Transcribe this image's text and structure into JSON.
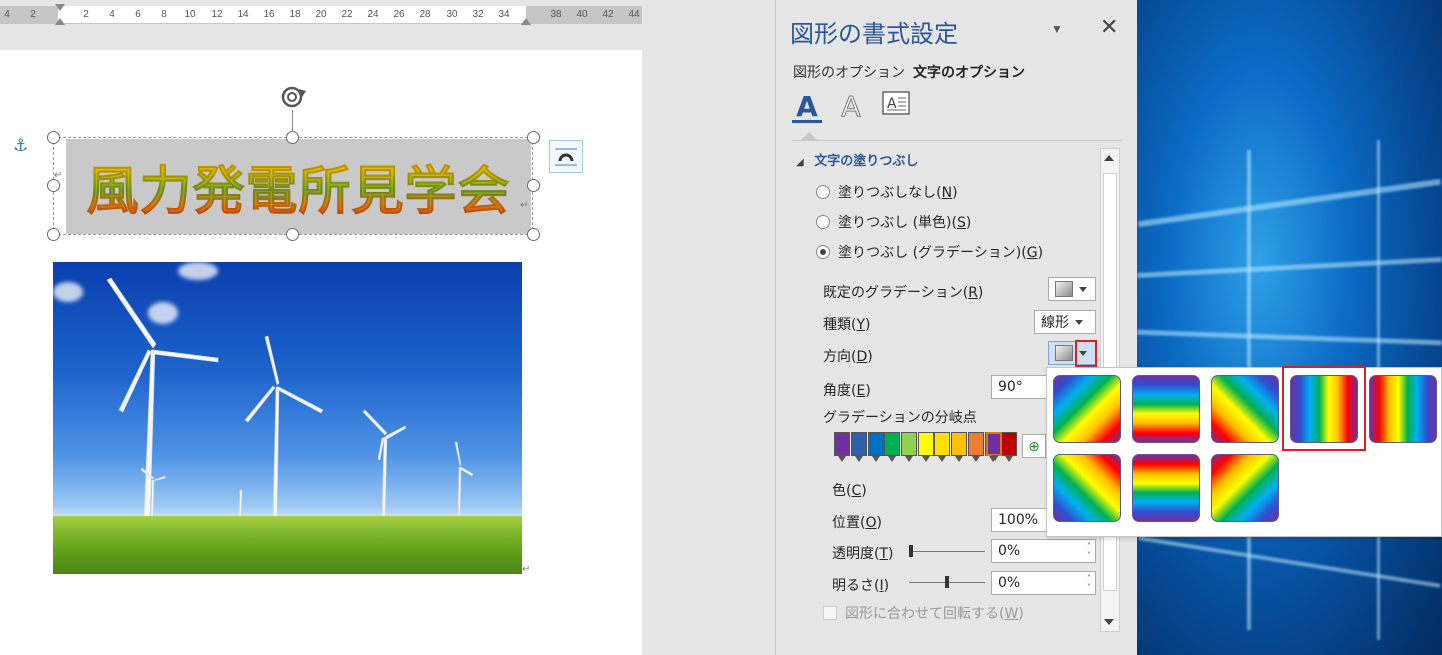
{
  "ruler": {
    "ticks": [
      "4",
      "2",
      "2",
      "4",
      "6",
      "8",
      "10",
      "12",
      "14",
      "16",
      "18",
      "20",
      "22",
      "24",
      "26",
      "28",
      "30",
      "32",
      "34",
      "38",
      "40",
      "42",
      "44"
    ]
  },
  "document": {
    "wordart_text": "風力発電所見学会",
    "paragraph_mark": "↵",
    "anchor_icon": "anchor-icon",
    "image_subject": "wind-turbines-photo"
  },
  "pane": {
    "title": "図形の書式設定",
    "tabs": [
      "図形のオプション",
      "文字のオプション"
    ],
    "active_tab": "文字のオプション",
    "icon_tabs": [
      "text-fill-icon",
      "text-outline-icon",
      "text-box-icon"
    ],
    "section": {
      "title": "文字の塗りつぶし",
      "fill_options": {
        "none": {
          "text": "塗りつぶしなし(",
          "key": "N",
          "end": ")"
        },
        "solid": {
          "text": "塗りつぶし (単色)(",
          "key": "S",
          "end": ")"
        },
        "gradient": {
          "text": "塗りつぶし (グラデーション)(",
          "key": "G",
          "end": ")"
        }
      },
      "selected_fill": "gradient",
      "preset_gradient": {
        "text": "既定のグラデーション(",
        "key": "R",
        "end": ")"
      },
      "type": {
        "text": "種類(",
        "key": "Y",
        "end": ")",
        "value": "線形"
      },
      "direction": {
        "text": "方向(",
        "key": "D",
        "end": ")"
      },
      "angle": {
        "text": "角度(",
        "key": "E",
        "end": ")",
        "value": "90°"
      },
      "gradient_stops_label": "グラデーションの分岐点",
      "color": {
        "text": "色(",
        "key": "C",
        "end": ")"
      },
      "position": {
        "text": "位置(",
        "key": "O",
        "end": ")",
        "value": "100%"
      },
      "transparency": {
        "text": "透明度(",
        "key": "T",
        "end": ")",
        "value": "0%"
      },
      "brightness": {
        "text": "明るさ(",
        "key": "I",
        "end": ")",
        "value": "0%"
      },
      "rotate_with_shape": {
        "text": "図形に合わせて回転する(",
        "key": "W",
        "end": ")"
      }
    },
    "stop_colors": [
      "#7030a0",
      "#2f5fa8",
      "#0070c0",
      "#00b050",
      "#92d050",
      "#ffff00",
      "#ffe100",
      "#ffc000",
      "#ed7d31",
      "#ff0000",
      "#c00000",
      "#7030a0"
    ]
  },
  "gallery": {
    "name": "direction-gallery",
    "selected_index": 3,
    "rainbow_colors": [
      "#7030a0",
      "#2f4fd0",
      "#00b0f0",
      "#00b050",
      "#ffff00",
      "#ffc000",
      "#ff0000",
      "#7030a0"
    ]
  },
  "colors": {
    "accent": "#2b579a",
    "highlight": "#e02020"
  }
}
